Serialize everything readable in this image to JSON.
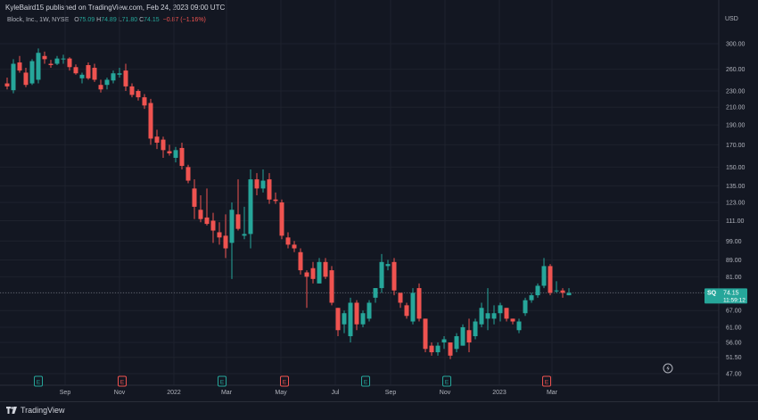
{
  "header": {
    "publish_text": "KyleBaird15 published on TradingView.com, Feb 24, 2023 09:00 UTC",
    "symbol_text": "Block, Inc., 1W, NYSE",
    "open_label": "O",
    "open_value": "75.09",
    "high_label": "H",
    "high_value": "74.89",
    "low_label": "L",
    "low_value": "71.80",
    "close_label": "C",
    "close_value": "74.15",
    "change_text": "−0.87 (−1.16%)"
  },
  "price_scale": {
    "currency": "USD",
    "last_price_symbol": "SQ",
    "last_price_value": "74.15",
    "countdown": "11:59:12"
  },
  "footer": {
    "logo_text": "TradingView"
  },
  "colors": {
    "background": "#131722",
    "up": "#26a69a",
    "down": "#ef5350",
    "grid": "#1e222d",
    "text": "#b2b5be"
  },
  "chart_data": {
    "type": "candlestick",
    "scale": "log",
    "y_tick_labels": [
      "300.00",
      "260.00",
      "230.00",
      "210.00",
      "190.00",
      "170.00",
      "150.00",
      "135.00",
      "123.00",
      "111.00",
      "99.00",
      "89.00",
      "81.00",
      "74.00",
      "67.00",
      "61.00",
      "56.00",
      "51.50",
      "47.00"
    ],
    "x_tick_labels": [
      "Sep",
      "Nov",
      "2022",
      "Mar",
      "May",
      "Jul",
      "Sep",
      "Nov",
      "2023",
      "Mar"
    ],
    "earnings_markers": [
      {
        "date": "2021-08-02",
        "label": "E",
        "status": "up"
      },
      {
        "date": "2021-11-04",
        "label": "E",
        "status": "down"
      },
      {
        "date": "2022-02-24",
        "label": "E",
        "status": "up"
      },
      {
        "date": "2022-05-05",
        "label": "E",
        "status": "down"
      },
      {
        "date": "2022-08-04",
        "label": "E",
        "status": "up"
      },
      {
        "date": "2022-11-03",
        "label": "E",
        "status": "up"
      },
      {
        "date": "2023-02-23",
        "label": "E",
        "status": "down"
      }
    ],
    "candles": [
      {
        "t": "2021-06-28",
        "o": 240,
        "h": 248,
        "l": 232,
        "c": 236
      },
      {
        "t": "2021-07-05",
        "o": 231,
        "h": 275,
        "l": 227,
        "c": 268
      },
      {
        "t": "2021-07-12",
        "o": 270,
        "h": 280,
        "l": 255,
        "c": 258
      },
      {
        "t": "2021-07-19",
        "o": 255,
        "h": 262,
        "l": 235,
        "c": 238
      },
      {
        "t": "2021-07-26",
        "o": 240,
        "h": 275,
        "l": 238,
        "c": 272
      },
      {
        "t": "2021-08-02",
        "o": 245,
        "h": 292,
        "l": 240,
        "c": 285
      },
      {
        "t": "2021-08-09",
        "o": 280,
        "h": 287,
        "l": 268,
        "c": 275
      },
      {
        "t": "2021-08-16",
        "o": 268,
        "h": 274,
        "l": 262,
        "c": 266
      },
      {
        "t": "2021-08-23",
        "o": 268,
        "h": 280,
        "l": 266,
        "c": 276
      },
      {
        "t": "2021-08-30",
        "o": 275,
        "h": 282,
        "l": 268,
        "c": 276
      },
      {
        "t": "2021-09-06",
        "o": 276,
        "h": 278,
        "l": 258,
        "c": 263
      },
      {
        "t": "2021-09-13",
        "o": 263,
        "h": 267,
        "l": 252,
        "c": 254
      },
      {
        "t": "2021-09-20",
        "o": 247,
        "h": 255,
        "l": 240,
        "c": 252
      },
      {
        "t": "2021-09-27",
        "o": 266,
        "h": 270,
        "l": 245,
        "c": 247
      },
      {
        "t": "2021-10-04",
        "o": 262,
        "h": 268,
        "l": 242,
        "c": 245
      },
      {
        "t": "2021-10-11",
        "o": 238,
        "h": 245,
        "l": 228,
        "c": 232
      },
      {
        "t": "2021-10-18",
        "o": 238,
        "h": 248,
        "l": 232,
        "c": 245
      },
      {
        "t": "2021-10-25",
        "o": 244,
        "h": 258,
        "l": 240,
        "c": 254
      },
      {
        "t": "2021-11-01",
        "o": 252,
        "h": 262,
        "l": 248,
        "c": 254
      },
      {
        "t": "2021-11-08",
        "o": 258,
        "h": 268,
        "l": 230,
        "c": 236
      },
      {
        "t": "2021-11-15",
        "o": 236,
        "h": 240,
        "l": 222,
        "c": 225
      },
      {
        "t": "2021-11-22",
        "o": 230,
        "h": 232,
        "l": 218,
        "c": 222
      },
      {
        "t": "2021-11-29",
        "o": 222,
        "h": 226,
        "l": 208,
        "c": 212
      },
      {
        "t": "2021-12-06",
        "o": 215,
        "h": 220,
        "l": 170,
        "c": 176
      },
      {
        "t": "2021-12-13",
        "o": 178,
        "h": 185,
        "l": 166,
        "c": 172
      },
      {
        "t": "2021-12-20",
        "o": 175,
        "h": 178,
        "l": 158,
        "c": 165
      },
      {
        "t": "2021-12-27",
        "o": 164,
        "h": 170,
        "l": 160,
        "c": 162
      },
      {
        "t": "2022-01-03",
        "o": 158,
        "h": 168,
        "l": 154,
        "c": 165
      },
      {
        "t": "2022-01-10",
        "o": 167,
        "h": 172,
        "l": 148,
        "c": 151
      },
      {
        "t": "2022-01-17",
        "o": 150,
        "h": 152,
        "l": 137,
        "c": 139
      },
      {
        "t": "2022-01-24",
        "o": 133,
        "h": 140,
        "l": 112,
        "c": 120
      },
      {
        "t": "2022-01-31",
        "o": 118,
        "h": 128,
        "l": 110,
        "c": 112
      },
      {
        "t": "2022-02-07",
        "o": 113,
        "h": 133,
        "l": 108,
        "c": 109
      },
      {
        "t": "2022-02-14",
        "o": 111,
        "h": 116,
        "l": 98,
        "c": 105
      },
      {
        "t": "2022-02-21",
        "o": 104,
        "h": 110,
        "l": 97,
        "c": 101
      },
      {
        "t": "2022-02-28",
        "o": 102,
        "h": 115,
        "l": 90,
        "c": 95
      },
      {
        "t": "2022-03-07",
        "o": 98,
        "h": 123,
        "l": 80,
        "c": 118
      },
      {
        "t": "2022-03-14",
        "o": 115,
        "h": 140,
        "l": 105,
        "c": 106
      },
      {
        "t": "2022-03-21",
        "o": 102,
        "h": 120,
        "l": 100,
        "c": 103
      },
      {
        "t": "2022-03-28",
        "o": 103,
        "h": 148,
        "l": 95,
        "c": 140
      },
      {
        "t": "2022-04-04",
        "o": 140,
        "h": 145,
        "l": 128,
        "c": 133
      },
      {
        "t": "2022-04-11",
        "o": 133,
        "h": 148,
        "l": 130,
        "c": 139
      },
      {
        "t": "2022-04-18",
        "o": 140,
        "h": 145,
        "l": 122,
        "c": 125
      },
      {
        "t": "2022-04-25",
        "o": 125,
        "h": 130,
        "l": 122,
        "c": 124
      },
      {
        "t": "2022-05-02",
        "o": 123,
        "h": 125,
        "l": 100,
        "c": 102
      },
      {
        "t": "2022-05-09",
        "o": 101,
        "h": 104,
        "l": 95,
        "c": 97
      },
      {
        "t": "2022-05-16",
        "o": 97,
        "h": 99,
        "l": 93,
        "c": 95
      },
      {
        "t": "2022-05-23",
        "o": 93,
        "h": 95,
        "l": 82,
        "c": 84
      },
      {
        "t": "2022-05-30",
        "o": 83,
        "h": 84,
        "l": 68,
        "c": 81
      },
      {
        "t": "2022-06-06",
        "o": 85,
        "h": 88,
        "l": 78,
        "c": 80
      },
      {
        "t": "2022-06-13",
        "o": 78,
        "h": 90,
        "l": 78,
        "c": 88
      },
      {
        "t": "2022-06-20",
        "o": 88,
        "h": 90,
        "l": 80,
        "c": 81
      },
      {
        "t": "2022-06-27",
        "o": 84,
        "h": 86,
        "l": 69,
        "c": 70
      },
      {
        "t": "2022-07-04",
        "o": 68,
        "h": 68,
        "l": 58,
        "c": 60
      },
      {
        "t": "2022-07-11",
        "o": 62,
        "h": 67,
        "l": 59,
        "c": 66
      },
      {
        "t": "2022-07-18",
        "o": 58,
        "h": 72,
        "l": 56,
        "c": 70
      },
      {
        "t": "2022-07-25",
        "o": 70,
        "h": 71,
        "l": 60,
        "c": 62
      },
      {
        "t": "2022-08-01",
        "o": 62,
        "h": 67,
        "l": 61,
        "c": 66
      },
      {
        "t": "2022-08-08",
        "o": 64,
        "h": 71,
        "l": 63,
        "c": 70
      },
      {
        "t": "2022-08-15",
        "o": 72,
        "h": 76,
        "l": 70,
        "c": 76
      },
      {
        "t": "2022-08-22",
        "o": 76,
        "h": 92,
        "l": 74,
        "c": 88
      },
      {
        "t": "2022-08-29",
        "o": 86,
        "h": 89,
        "l": 84,
        "c": 87
      },
      {
        "t": "2022-09-05",
        "o": 88,
        "h": 90,
        "l": 73,
        "c": 75
      },
      {
        "t": "2022-09-12",
        "o": 74,
        "h": 74,
        "l": 68,
        "c": 70
      },
      {
        "t": "2022-09-19",
        "o": 69,
        "h": 70,
        "l": 64,
        "c": 65
      },
      {
        "t": "2022-09-26",
        "o": 63,
        "h": 76,
        "l": 62,
        "c": 74
      },
      {
        "t": "2022-10-03",
        "o": 76,
        "h": 78,
        "l": 63,
        "c": 64
      },
      {
        "t": "2022-10-10",
        "o": 64,
        "h": 64,
        "l": 53,
        "c": 54
      },
      {
        "t": "2022-10-17",
        "o": 55,
        "h": 56,
        "l": 52,
        "c": 53
      },
      {
        "t": "2022-10-24",
        "o": 53,
        "h": 56,
        "l": 52,
        "c": 55
      },
      {
        "t": "2022-10-31",
        "o": 56,
        "h": 58,
        "l": 54,
        "c": 57
      },
      {
        "t": "2022-11-07",
        "o": 56,
        "h": 56,
        "l": 51,
        "c": 52
      },
      {
        "t": "2022-11-14",
        "o": 54,
        "h": 59,
        "l": 53,
        "c": 58
      },
      {
        "t": "2022-11-21",
        "o": 55,
        "h": 62,
        "l": 55,
        "c": 61
      },
      {
        "t": "2022-11-28",
        "o": 60,
        "h": 64,
        "l": 53,
        "c": 56
      },
      {
        "t": "2022-12-05",
        "o": 58,
        "h": 64,
        "l": 57,
        "c": 63
      },
      {
        "t": "2022-12-12",
        "o": 62,
        "h": 70,
        "l": 61,
        "c": 68
      },
      {
        "t": "2022-12-19",
        "o": 64,
        "h": 76,
        "l": 60,
        "c": 66
      },
      {
        "t": "2022-12-26",
        "o": 64,
        "h": 69,
        "l": 62,
        "c": 66
      },
      {
        "t": "2023-01-02",
        "o": 66,
        "h": 70,
        "l": 63,
        "c": 69
      },
      {
        "t": "2023-01-09",
        "o": 68,
        "h": 68,
        "l": 63,
        "c": 64
      },
      {
        "t": "2023-01-16",
        "o": 64,
        "h": 64,
        "l": 62,
        "c": 63
      },
      {
        "t": "2023-01-23",
        "o": 60,
        "h": 64,
        "l": 59,
        "c": 63
      },
      {
        "t": "2023-01-30",
        "o": 66,
        "h": 72,
        "l": 65,
        "c": 71
      },
      {
        "t": "2023-02-06",
        "o": 71,
        "h": 74,
        "l": 70,
        "c": 73
      },
      {
        "t": "2023-02-13",
        "o": 73,
        "h": 78,
        "l": 72,
        "c": 77
      },
      {
        "t": "2023-02-20",
        "o": 77,
        "h": 90,
        "l": 76,
        "c": 86
      },
      {
        "t": "2023-02-27",
        "o": 86,
        "h": 87,
        "l": 73,
        "c": 74
      },
      {
        "t": "2023-03-06",
        "o": 75,
        "h": 79,
        "l": 74,
        "c": 75
      },
      {
        "t": "2023-03-13",
        "o": 75,
        "h": 76,
        "l": 72,
        "c": 74
      },
      {
        "t": "2023-03-20",
        "o": 73,
        "h": 76,
        "l": 73,
        "c": 74
      }
    ]
  }
}
